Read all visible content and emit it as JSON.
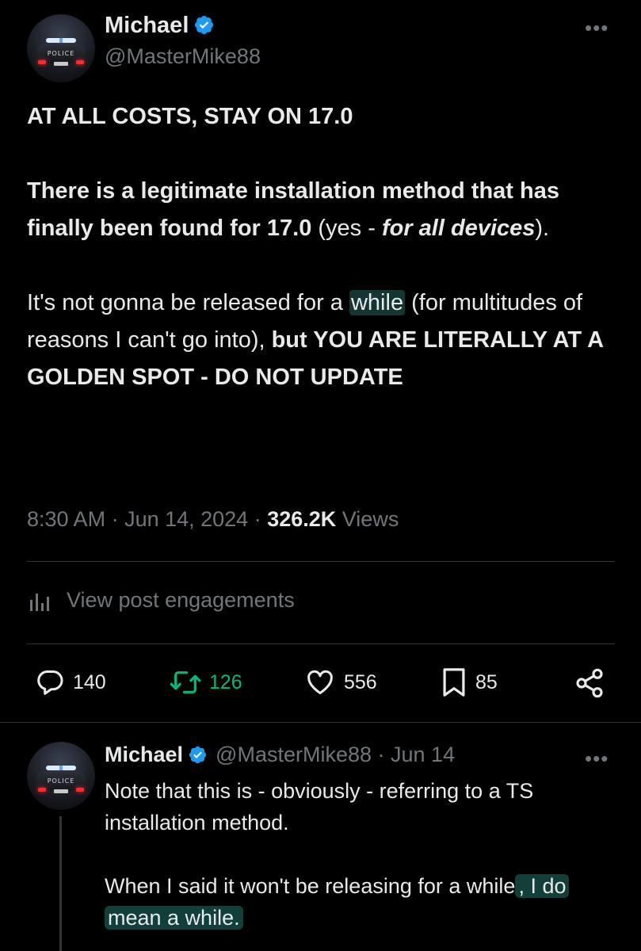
{
  "post": {
    "author": {
      "name": "Michael",
      "handle": "@MasterMike88",
      "avatar_label": "POLICE"
    },
    "paragraphs": {
      "p1": "AT ALL COSTS, STAY ON 17.0",
      "p2_bold": "There is a legitimate installation method that has finally been found for 17.0",
      "p2_plain": " (yes - ",
      "p2_italic": "for all devices",
      "p2_end": ").",
      "p3_a": "It's not gonna be released for a ",
      "p3_highlight": "while",
      "p3_b": " (for multitudes of reasons I can't go into), ",
      "p3_bold": "but YOU ARE LITERALLY AT A GOLDEN SPOT - DO NOT UPDATE"
    },
    "meta": {
      "time": "8:30 AM",
      "sep1": " · ",
      "date": "Jun 14, 2024",
      "sep2": " · ",
      "views_count": "326.2K",
      "views_label": " Views"
    },
    "engagements_label": "View post engagements",
    "actions": {
      "replies": "140",
      "reposts": "126",
      "likes": "556",
      "bookmarks": "85"
    }
  },
  "reply": {
    "author": {
      "name": "Michael",
      "handle": "@MasterMike88",
      "sep": " · ",
      "date": "Jun 14",
      "avatar_label": "POLICE"
    },
    "line1": "Note that this is - obviously - referring to a TS installation method.",
    "line2_a": "When I said it won't be releasing for a whil",
    "line2_b": "e",
    "line2_highlight_a": ", I do",
    "line2_highlight_b": "mean a while."
  },
  "colors": {
    "background": "#000000",
    "text": "#e7e9ea",
    "secondary": "#71767b",
    "verified": "#1d9bf0",
    "repost_active": "#00ba7c",
    "highlight": "#2a786e"
  },
  "icons": {
    "more": "more-dots-icon",
    "verified": "verified-badge-icon",
    "engagements": "bar-chart-icon",
    "reply": "speech-bubble-icon",
    "repost": "repost-arrows-icon",
    "like": "heart-icon",
    "bookmark": "bookmark-icon",
    "share": "share-icon"
  }
}
